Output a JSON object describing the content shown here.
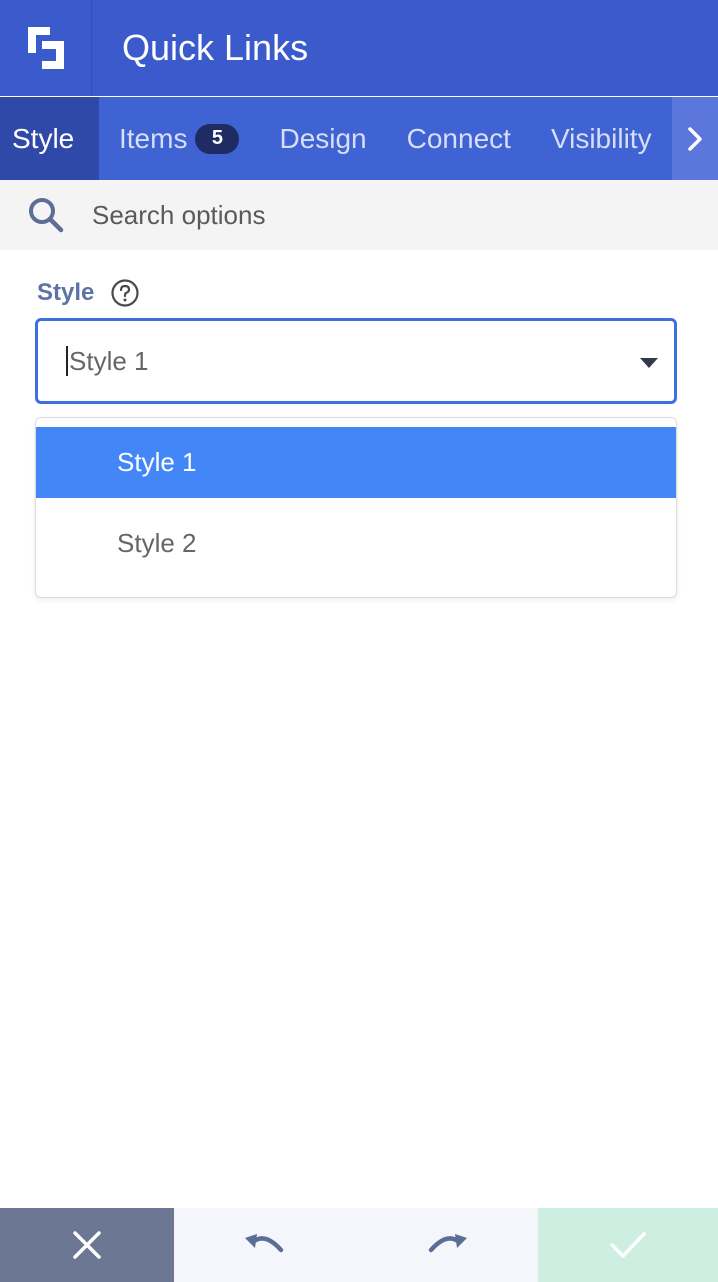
{
  "header": {
    "title": "Quick Links",
    "logo_icon": "logo-icon"
  },
  "tabs": [
    {
      "label": "Style",
      "active": true
    },
    {
      "label": "Items",
      "badge": "5"
    },
    {
      "label": "Design"
    },
    {
      "label": "Connect"
    },
    {
      "label": "Visibility"
    }
  ],
  "search": {
    "placeholder": "Search options"
  },
  "field": {
    "label": "Style",
    "value": "Style 1",
    "options": [
      "Style 1",
      "Style 2"
    ],
    "selected": "Style 1"
  },
  "colors": {
    "header": "#3b5bcc",
    "tabs": "#3f63d3",
    "active_tab": "#2e49a8",
    "selected_option": "#4386f7",
    "select_border": "#3d6fe0",
    "cancel": "#6c7893",
    "save": "#cfeee2"
  },
  "footer": {
    "cancel_icon": "close-icon",
    "undo_icon": "undo-icon",
    "redo_icon": "redo-icon",
    "save_icon": "check-icon"
  }
}
